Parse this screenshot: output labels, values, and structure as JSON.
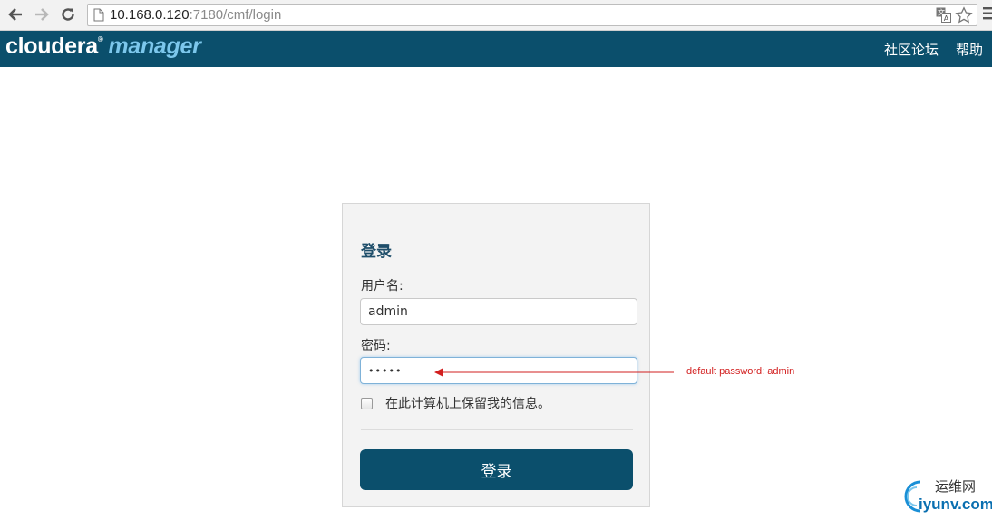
{
  "browser": {
    "url_host": "10.168.0.120",
    "url_rest": ":7180/cmf/login",
    "back_icon": "arrow-left-icon",
    "forward_icon": "arrow-right-icon",
    "reload_icon": "reload-icon",
    "page_icon": "page-icon",
    "translate_icon": "translate-icon",
    "bookmark_icon": "star-icon",
    "menu_icon": "menu-icon"
  },
  "header": {
    "logo_part1": "cloudera",
    "logo_reg": "®",
    "logo_part2": "manager",
    "links": [
      "社区论坛",
      "帮助"
    ],
    "bg_color": "#0b4f6c"
  },
  "login": {
    "title": "登录",
    "username_label": "用户名:",
    "username_value": "admin",
    "password_label": "密码:",
    "password_masked": "•••••",
    "remember_label": "在此计算机上保留我的信息。",
    "remember_checked": false,
    "submit_label": "登录"
  },
  "annotation": {
    "text": "default password: admin",
    "color": "#d21f1f"
  },
  "watermark": {
    "line1": "运维网",
    "line2": "iyunv.com"
  }
}
